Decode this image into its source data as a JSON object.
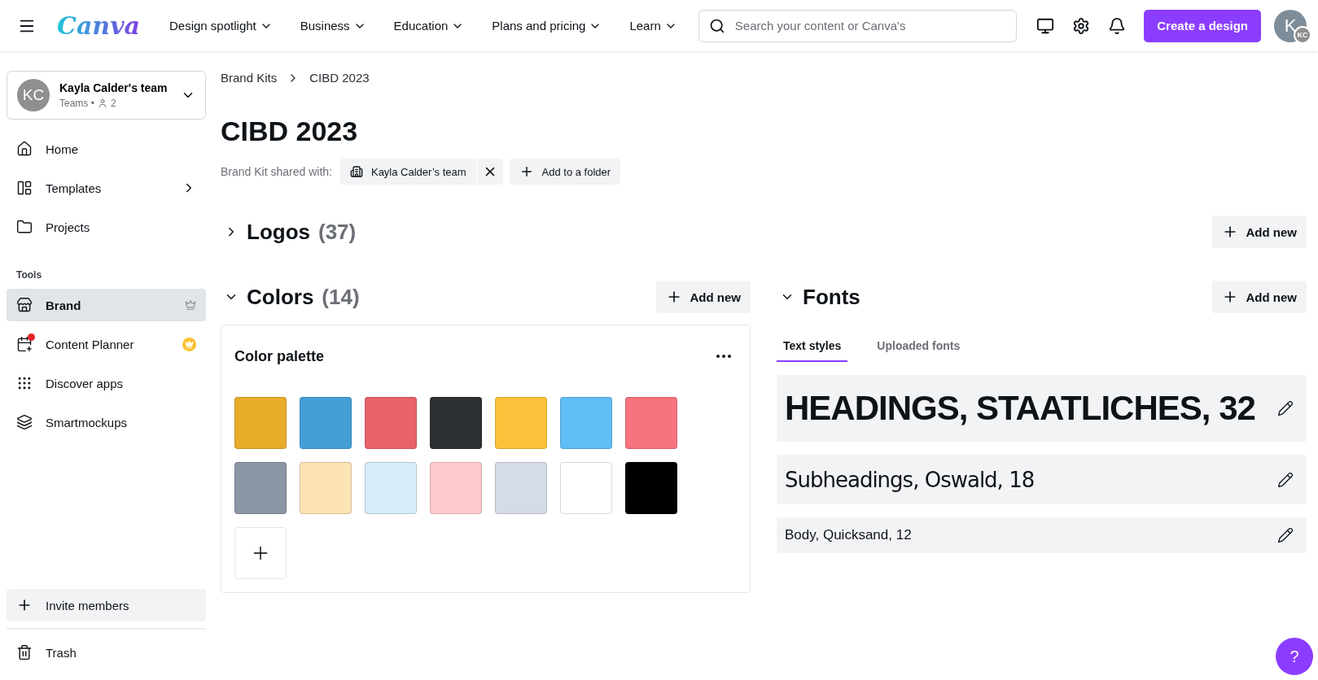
{
  "topbar": {
    "logo": "Canva",
    "nav": [
      "Design spotlight",
      "Business",
      "Education",
      "Plans and pricing",
      "Learn"
    ],
    "search": {
      "placeholder": "Search your content or Canva's"
    },
    "create_button": "Create a design",
    "avatar": {
      "initial": "K",
      "badge": "KC"
    }
  },
  "sidebar": {
    "team": {
      "initials": "KC",
      "name": "Kayla Calder's team",
      "plan": "Teams •",
      "members": "2"
    },
    "items": [
      {
        "label": "Home",
        "selected": false,
        "has_submenu": false
      },
      {
        "label": "Templates",
        "selected": false,
        "has_submenu": true
      },
      {
        "label": "Projects",
        "selected": false,
        "has_submenu": false
      }
    ],
    "tools_heading": "Tools",
    "tools": [
      {
        "label": "Brand",
        "selected": true,
        "premium": true,
        "notification": false
      },
      {
        "label": "Content Planner",
        "selected": false,
        "premium": true,
        "notification": true
      },
      {
        "label": "Discover apps",
        "selected": false,
        "premium": false,
        "notification": false
      },
      {
        "label": "Smartmockups",
        "selected": false,
        "premium": false,
        "notification": false
      }
    ],
    "invite": "Invite members",
    "trash": "Trash"
  },
  "main": {
    "breadcrumb": [
      "Brand Kits",
      "CIBD 2023"
    ],
    "title": "CIBD 2023",
    "shared_label": "Brand Kit shared with:",
    "shared_chip": "Kayla Calder’s team",
    "add_folder": "Add to a folder",
    "logos": {
      "title": "Logos",
      "count": "(37)",
      "expanded": false,
      "add": "Add new"
    },
    "colors": {
      "title": "Colors",
      "count": "(14)",
      "expanded": true,
      "add": "Add new",
      "palette": {
        "title": "Color palette",
        "swatches": [
          {
            "color": "#e8ac2b"
          },
          {
            "color": "#459fd6"
          },
          {
            "color": "#e8616b"
          },
          {
            "color": "#2d3133"
          },
          {
            "color": "#fbc13a"
          },
          {
            "color": "#60bef5"
          },
          {
            "color": "#f7737f"
          },
          {
            "color": "#8b95a4"
          },
          {
            "color": "#fbe3b3"
          },
          {
            "color": "#d5edf9"
          },
          {
            "color": "#fdc8ce"
          },
          {
            "color": "#d6dce6"
          },
          {
            "color": "#ffffff"
          },
          {
            "color": "#000000"
          }
        ]
      }
    },
    "fonts": {
      "title": "Fonts",
      "expanded": true,
      "add": "Add new",
      "tabs": [
        {
          "label": "Text styles",
          "selected": true
        },
        {
          "label": "Uploaded fonts",
          "selected": false
        }
      ],
      "styles": [
        {
          "kind": "heading",
          "text": "HEADINGS, STAATLICHES, 32"
        },
        {
          "kind": "subheading",
          "text": "Subheadings, Oswald, 18"
        },
        {
          "kind": "body",
          "text": "Body, Quicksand, 12"
        }
      ]
    }
  },
  "help_button": "?"
}
